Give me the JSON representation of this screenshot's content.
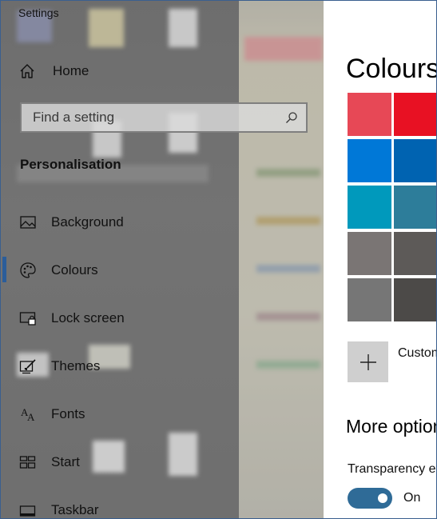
{
  "window": {
    "title": "Settings"
  },
  "nav": {
    "home_label": "Home",
    "search": {
      "placeholder": "Find a setting"
    },
    "section_title": "Personalisation",
    "items": [
      {
        "label": "Background",
        "icon": "picture-icon"
      },
      {
        "label": "Colours",
        "icon": "palette-icon",
        "active": true
      },
      {
        "label": "Lock screen",
        "icon": "lock-screen-icon"
      },
      {
        "label": "Themes",
        "icon": "themes-brush-icon"
      },
      {
        "label": "Fonts",
        "icon": "fonts-icon"
      },
      {
        "label": "Start",
        "icon": "start-tiles-icon"
      },
      {
        "label": "Taskbar",
        "icon": "taskbar-icon"
      }
    ]
  },
  "main": {
    "heading": "Colours",
    "swatches": [
      [
        "#e74856",
        "#e81123"
      ],
      [
        "#0078d7",
        "#0063b1"
      ],
      [
        "#0099bc",
        "#2d7d9a"
      ],
      [
        "#7a7574",
        "#5d5a58"
      ],
      [
        "#767676",
        "#4c4a48"
      ]
    ],
    "custom_label": "Custom colour",
    "more_options_heading": "More options",
    "transparency_label": "Transparency effects",
    "transparency_state": "On"
  },
  "colors": {
    "accent": "#2b5d9a",
    "toggle_on": "#2f6b97"
  }
}
